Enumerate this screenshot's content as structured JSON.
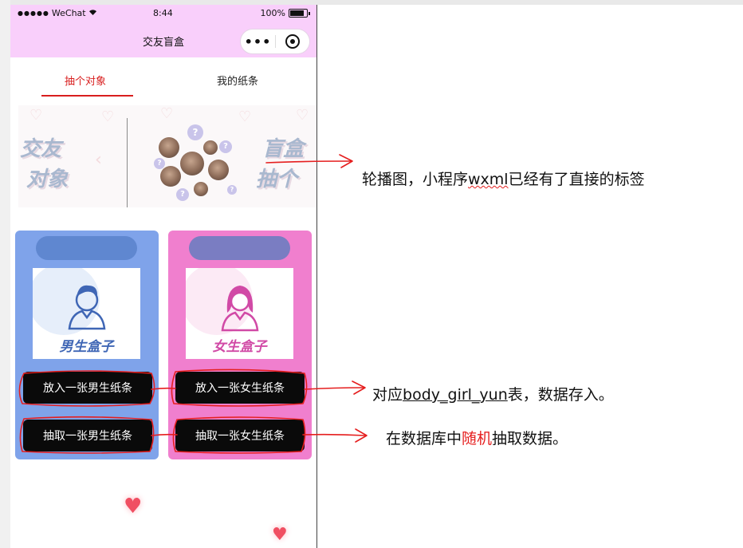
{
  "status_bar": {
    "carrier": "WeChat",
    "time": "8:44",
    "battery": "100%"
  },
  "nav": {
    "title": "交友盲盒",
    "more_icon": "more-dots-icon",
    "close_icon": "target-close-icon"
  },
  "tabs": [
    {
      "label": "抽个对象",
      "active": true
    },
    {
      "label": "我的纸条",
      "active": false
    }
  ],
  "carousel": {
    "text_left_1": "交友",
    "text_left_2": "对象",
    "text_right_1": "盲盒",
    "text_right_2": "抽个"
  },
  "cards": {
    "boy": {
      "label": "男生盒子",
      "put_button": "放入一张男生纸条",
      "draw_button": "抽取一张男生纸条"
    },
    "girl": {
      "label": "女生盒子",
      "put_button": "放入一张女生纸条",
      "draw_button": "抽取一张女生纸条"
    }
  },
  "annotations": {
    "carousel": {
      "before": "轮播图，小程序",
      "underlined": "wxml",
      "after": "已经有了直接的标签"
    },
    "put": {
      "before": "对应",
      "underlined": "body_girl_yun",
      "after": "表，数据存入。"
    },
    "draw": {
      "before": "在数据库中",
      "highlight": "随机",
      "after": "抽取数据。"
    }
  },
  "colors": {
    "header_pink": "#f9cffb",
    "active_tab": "#d81e1e",
    "boy_card": "#7fa3ea",
    "girl_card": "#f07fce",
    "button": "#0a0a0a",
    "annotation_red": "#e51e1e"
  }
}
